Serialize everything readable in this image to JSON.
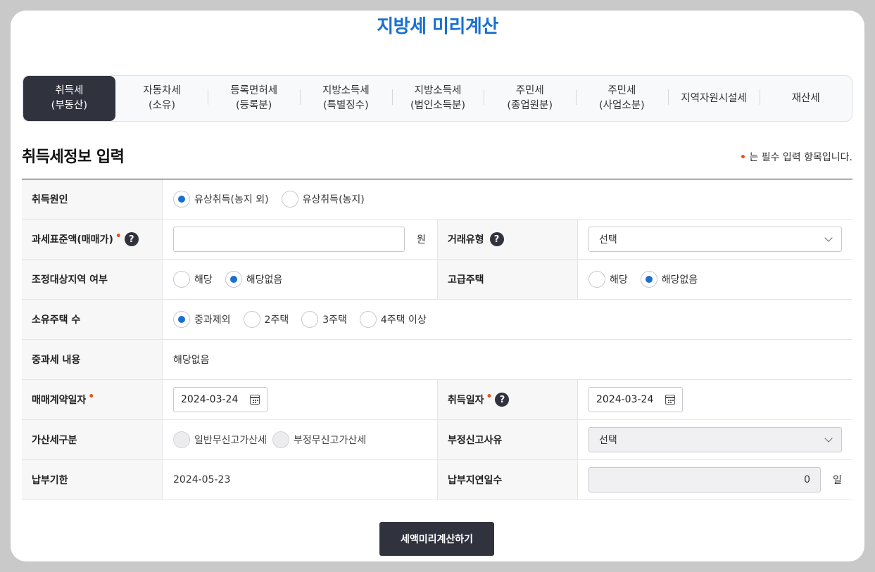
{
  "title": "지방세 미리계산",
  "tabs": [
    {
      "line1": "취득세",
      "line2": "(부동산)"
    },
    {
      "line1": "자동차세",
      "line2": "(소유)"
    },
    {
      "line1": "등록면허세",
      "line2": "(등록분)"
    },
    {
      "line1": "지방소득세",
      "line2": "(특별징수)"
    },
    {
      "line1": "지방소득세",
      "line2": "(법인소득분)"
    },
    {
      "line1": "주민세",
      "line2": "(종업원분)"
    },
    {
      "line1": "주민세",
      "line2": "(사업소분)"
    },
    {
      "line1": "지역자원시설세",
      "line2": ""
    },
    {
      "line1": "재산세",
      "line2": ""
    }
  ],
  "section_title": "취득세정보 입력",
  "required_note": "는 필수 입력 항목입니다.",
  "required_mark": "•",
  "help_icon": "?",
  "form": {
    "acq_cause": {
      "label": "취득원인",
      "options": [
        "유상취득(농지 외)",
        "유상취득(농지)"
      ]
    },
    "tax_base": {
      "label": "과세표준액(매매가)",
      "value": "",
      "unit": "원"
    },
    "trade_type": {
      "label": "거래유형",
      "selected": "선택"
    },
    "adjust_area": {
      "label": "조정대상지역 여부",
      "options": [
        "해당",
        "해당없음"
      ]
    },
    "luxury_house": {
      "label": "고급주택",
      "options": [
        "해당",
        "해당없음"
      ]
    },
    "house_count": {
      "label": "소유주택 수",
      "options": [
        "중과제외",
        "2주택",
        "3주택",
        "4주택 이상"
      ]
    },
    "heavy_tax": {
      "label": "중과세 내용",
      "value": "해당없음"
    },
    "contract_date": {
      "label": "매매계약일자",
      "value": "2024-03-24"
    },
    "acq_date": {
      "label": "취득일자",
      "value": "2024-03-24"
    },
    "penalty_type": {
      "label": "가산세구분",
      "options": [
        "일반무신고가산세",
        "부정무신고가산세"
      ]
    },
    "fraud_reason": {
      "label": "부정신고사유",
      "selected": "선택"
    },
    "due_date": {
      "label": "납부기한",
      "value": "2024-05-23"
    },
    "delay_days": {
      "label": "납부지연일수",
      "value": "0",
      "unit": "일"
    }
  },
  "calc_button": "세액미리계산하기",
  "colors": {
    "accent": "#1a6fd0",
    "dark": "#30323e",
    "required": "#e0561b"
  }
}
